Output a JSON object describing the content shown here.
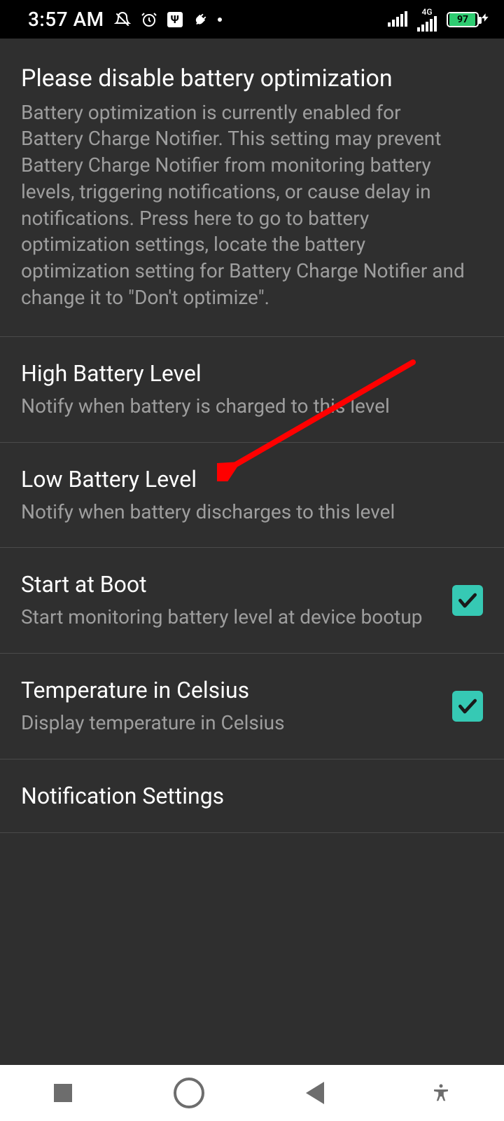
{
  "status": {
    "time": "3:57 AM",
    "network_label": "4G",
    "battery_percent": 97
  },
  "items": {
    "opt": {
      "title": "Please disable battery optimization",
      "body": "Battery optimization is currently enabled for Battery Charge Notifier. This setting may prevent Battery Charge Notifier from monitoring battery levels, triggering notifications, or cause delay in notifications. Press here to go to battery optimization settings, locate the battery optimization setting for Battery Charge Notifier and change it to \"Don't optimize\"."
    },
    "high": {
      "title": "High Battery Level",
      "body": "Notify when battery is charged to this level"
    },
    "low": {
      "title": "Low Battery Level",
      "body": "Notify when battery discharges to this level"
    },
    "boot": {
      "title": "Start at Boot",
      "body": "Start monitoring battery level at device bootup",
      "checked": true
    },
    "temp": {
      "title": "Temperature in Celsius",
      "body": "Display temperature in Celsius",
      "checked": true
    },
    "notif": {
      "title": "Notification Settings"
    }
  },
  "annotation": {
    "color": "#ff0000"
  }
}
